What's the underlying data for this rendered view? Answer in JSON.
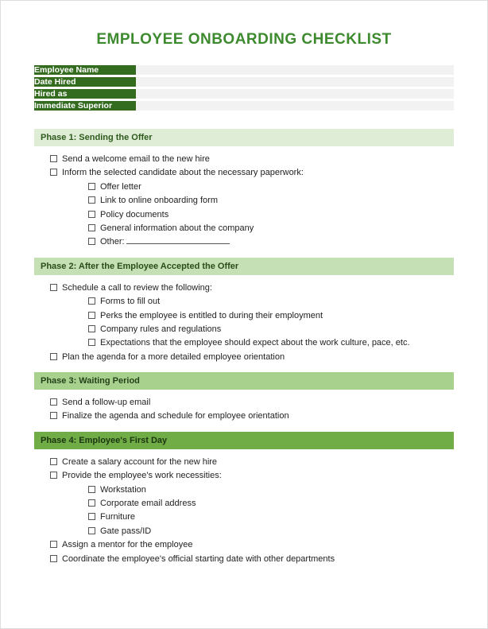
{
  "title": "EMPLOYEE ONBOARDING CHECKLIST",
  "info": {
    "rows": [
      {
        "label": "Employee Name",
        "value": ""
      },
      {
        "label": "Date Hired",
        "value": ""
      },
      {
        "label": "Hired as",
        "value": ""
      },
      {
        "label": "Immediate Superior",
        "value": ""
      }
    ]
  },
  "phases": {
    "p1": {
      "header": "Phase 1: Sending the Offer",
      "items": {
        "i1": "Send a welcome email to the new hire",
        "i2": "Inform the selected candidate about the necessary paperwork:",
        "subs": {
          "s1": "Offer letter",
          "s2": "Link to online onboarding form",
          "s3": "Policy documents",
          "s4": "General information about the company",
          "s5": "Other:"
        }
      }
    },
    "p2": {
      "header": "Phase 2: After the Employee Accepted the Offer",
      "items": {
        "i1": "Schedule a call to review the following:",
        "subs": {
          "s1": "Forms to fill out",
          "s2": "Perks the employee is entitled to during their employment",
          "s3": "Company rules and regulations",
          "s4": "Expectations that the employee should expect about the work culture, pace, etc."
        },
        "i2": "Plan the agenda for a more detailed employee orientation"
      }
    },
    "p3": {
      "header": "Phase 3: Waiting Period",
      "items": {
        "i1": "Send a follow-up email",
        "i2": "Finalize the agenda and schedule for employee orientation"
      }
    },
    "p4": {
      "header": "Phase 4: Employee's First Day",
      "items": {
        "i1": "Create a salary account for the new hire",
        "i2": "Provide the employee's work necessities:",
        "subs": {
          "s1": "Workstation",
          "s2": "Corporate email address",
          "s3": "Furniture",
          "s4": "Gate pass/ID"
        },
        "i3": "Assign a mentor for the employee",
        "i4": "Coordinate the employee's official starting date with other departments"
      }
    }
  }
}
